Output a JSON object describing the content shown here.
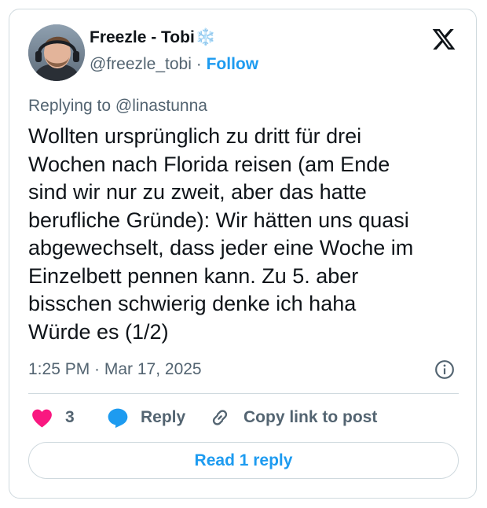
{
  "author": {
    "name": "Freezle - Tobi",
    "name_emoji": "❄️",
    "handle": "@freezle_tobi",
    "separator": "·",
    "follow_label": "Follow"
  },
  "replying_to": "Replying to @linastunna",
  "tweet_lines": [
    "Wollten ursprünglich zu dritt für drei",
    "Wochen nach Florida reisen (am Ende",
    "sind wir nur zu zweit, aber das hatte",
    "berufliche Gründe): Wir hätten uns quasi",
    "abgewechselt, dass jeder eine Woche im",
    "Einzelbett pennen kann. Zu 5. aber",
    "bisschen schwierig denke ich haha",
    "Würde es (1/2)"
  ],
  "timestamp": "1:25 PM · Mar 17, 2025",
  "actions": {
    "like_count": "3",
    "reply_label": "Reply",
    "copy_link_label": "Copy link to post"
  },
  "read_reply_label": "Read 1 reply",
  "colors": {
    "accent": "#1d9bf0",
    "heart": "#f91880",
    "muted": "#536471",
    "border": "#cfd9de"
  }
}
